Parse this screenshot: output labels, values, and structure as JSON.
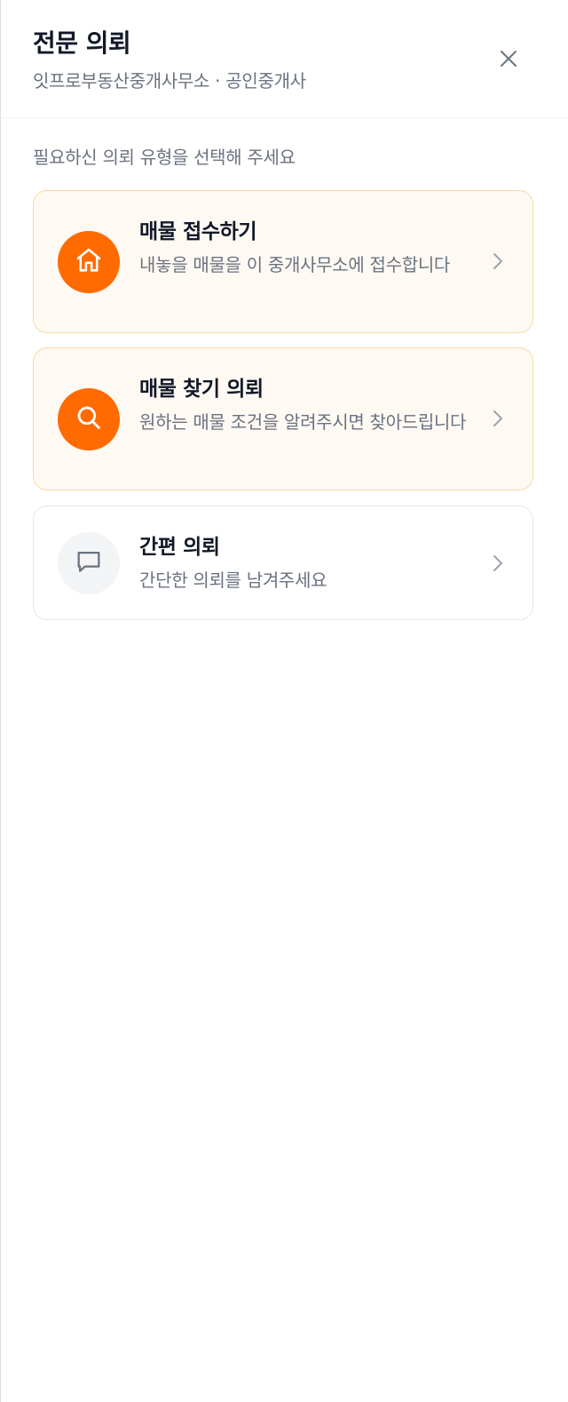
{
  "header": {
    "title": "전문 의뢰",
    "subtitle": "잇프로부동산중개사무소 · 공인중개사",
    "close_icon": "close-icon"
  },
  "prompt": "필요하신 의뢰 유형을 선택해 주세요",
  "options": [
    {
      "title": "매물 접수하기",
      "description": "내놓을 매물을 이 중개사무소에 접수합니다",
      "icon": "home-icon",
      "style": "accent"
    },
    {
      "title": "매물 찾기 의뢰",
      "description": "원하는 매물 조건을 알려주시면 찾아드립니다",
      "icon": "search-icon",
      "style": "accent"
    },
    {
      "title": "간편 의뢰",
      "description": "간단한 의뢰를 남겨주세요",
      "icon": "chat-icon",
      "style": "plain"
    }
  ],
  "colors": {
    "accent": "#ff6b00",
    "accent_card_bg": "#fff9f3",
    "accent_card_border": "#fcd9a5",
    "plain_card_border": "#e5e7eb",
    "muted_text": "#6b7280",
    "title_text": "#111827"
  }
}
